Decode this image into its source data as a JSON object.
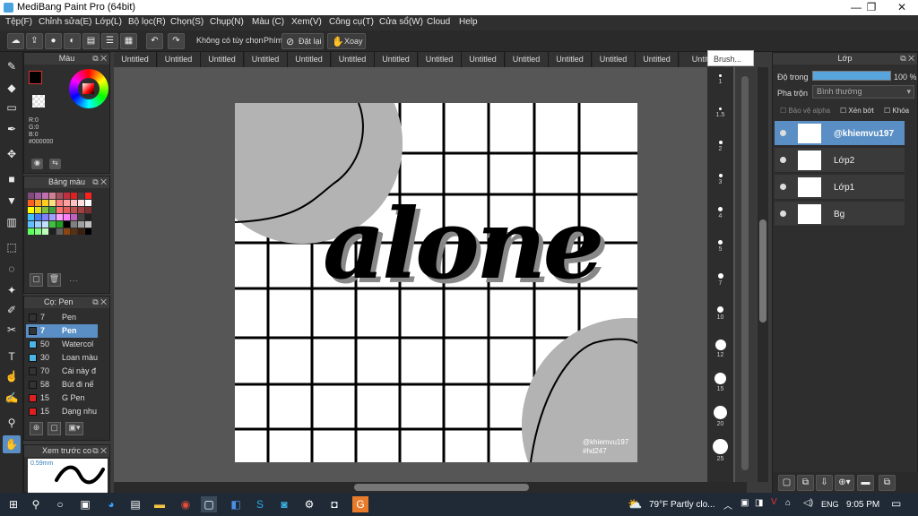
{
  "window": {
    "title": "MediBang Paint Pro (64bit)",
    "controls": [
      "—",
      "❐",
      "✕"
    ]
  },
  "menu": [
    "Tệp(F)",
    "Chỉnh sửa(E)",
    "Lớp(L)",
    "Bộ lọc(R)",
    "Chọn(S)",
    "Chụp(N)",
    "Màu (C)",
    "Xem(V)",
    "Công cụ(T)",
    "Cửa sổ(W)",
    "Cloud",
    "Help"
  ],
  "toolbar": {
    "no_selection": "Không có tùy chọn",
    "key_label": "Phím",
    "reset": "Đặt lại",
    "rotate": "Xoay"
  },
  "color_panel": {
    "title": "Màu",
    "rgb": [
      "R:0",
      "G:0",
      "B:0"
    ],
    "hex": "#000000",
    "primary_color": "#000000",
    "secondary_color": "#ffffff"
  },
  "palette_panel": {
    "title": "Bảng màu",
    "swatches": [
      "#7d4a7a",
      "#a05aa0",
      "#c070b0",
      "#d08090",
      "#a05060",
      "#c03040",
      "#e02020",
      "#404040",
      "#ff2020",
      "#ff6020",
      "#ffa020",
      "#ffd020",
      "#ffe080",
      "#ff8080",
      "#ffa0a0",
      "#ffc0c0",
      "#ffe0e0",
      "#ffffff",
      "#ffff00",
      "#e0e020",
      "#80c040",
      "#40a040",
      "#ff7070",
      "#e06060",
      "#c05050",
      "#a04040",
      "#803030",
      "#40c0ff",
      "#4080ff",
      "#8080ff",
      "#a0a0ff",
      "#ffa0ff",
      "#ff80ff",
      "#c060c0",
      "#404040",
      "#202020",
      "#60c0ff",
      "#a0d0ff",
      "#c0e0ff",
      "#40c040",
      "#20a020",
      "#000000",
      "#808080",
      "#a0a0a0",
      "#c0c0c0",
      "#60ff60",
      "#80ff80",
      "#c0ffc0",
      "#202020",
      "#606060",
      "#8b4513",
      "#5a3010",
      "#3a2010",
      "#000000"
    ],
    "more": "···"
  },
  "brush_panel": {
    "title": "Cọ: Pen",
    "brushes": [
      {
        "size": "7",
        "name": "Pen",
        "color": "#333333"
      },
      {
        "size": "7",
        "name": "Pen",
        "color": "#333333",
        "selected": true
      },
      {
        "size": "50",
        "name": "Watercol",
        "color": "#4ab6e8"
      },
      {
        "size": "30",
        "name": "Loan màu",
        "color": "#4ab6e8"
      },
      {
        "size": "70",
        "name": "Cái này đ",
        "color": "#333333"
      },
      {
        "size": "58",
        "name": "Bút đi nế",
        "color": "#333333"
      },
      {
        "size": "15",
        "name": "G Pen",
        "color": "#e02020"
      },
      {
        "size": "15",
        "name": "Dạng nhu",
        "color": "#e02020"
      }
    ]
  },
  "preview_panel": {
    "title": "Xem trước co",
    "size": "0.59mm"
  },
  "tabs": [
    "Untitled",
    "Untitled",
    "Untitled",
    "Untitled",
    "Untitled",
    "Untitled",
    "Untitled",
    "Untitled",
    "Untitled",
    "Untitled",
    "Untitled",
    "Untitled",
    "Untitled",
    "Untit"
  ],
  "brush_popup": "Brush...",
  "canvas": {
    "text": "alone",
    "watermark_line1": "@khiemvu197",
    "watermark_line2": "#hd247"
  },
  "brush_sizes": [
    "1",
    "1.5",
    "2",
    "3",
    "4",
    "5",
    "7",
    "10",
    "12",
    "15",
    "20",
    "25"
  ],
  "layers_panel": {
    "title": "Lớp",
    "opacity_label": "Độ trong",
    "opacity_value": "100 %",
    "opacity_fraction": 1.0,
    "blend_label": "Pha trộn",
    "blend_value": "Bình thường",
    "protect_alpha": "Bảo vệ alpha",
    "clipping": "Xén bớt",
    "lock": "Khóa",
    "layers": [
      {
        "name": "@khiemvu197",
        "selected": true
      },
      {
        "name": "Lớp2"
      },
      {
        "name": "Lớp1"
      },
      {
        "name": "Bg"
      }
    ]
  },
  "taskbar": {
    "weather": "79°F  Partly clo...",
    "lang": "ENG",
    "time": "9:05 PM"
  }
}
